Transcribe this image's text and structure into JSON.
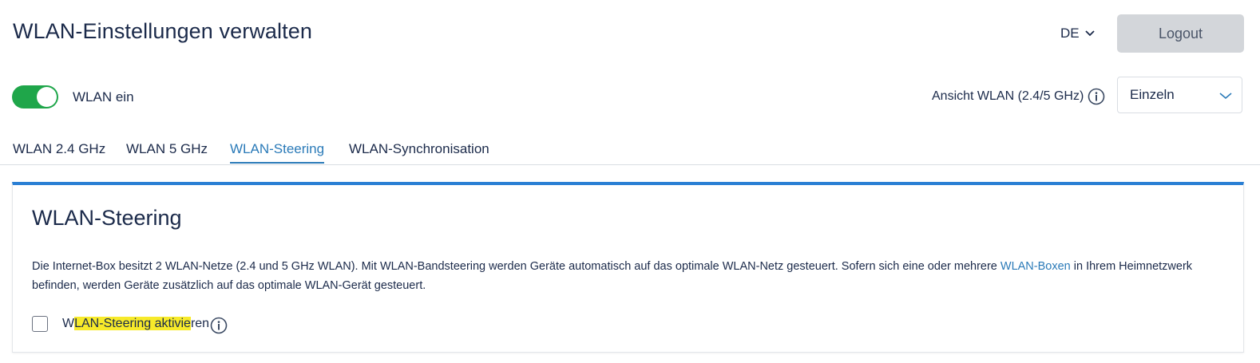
{
  "header": {
    "title": "WLAN-Einstellungen verwalten",
    "language": "DE",
    "logout_label": "Logout"
  },
  "wlan_toggle": {
    "label": "WLAN ein",
    "state": "on"
  },
  "view": {
    "label": "Ansicht WLAN (2.4/5 GHz)",
    "selected": "Einzeln"
  },
  "tabs": [
    {
      "label": "WLAN 2.4 GHz",
      "active": false
    },
    {
      "label": "WLAN 5 GHz",
      "active": false
    },
    {
      "label": "WLAN-Steering",
      "active": true
    },
    {
      "label": "WLAN-Synchronisation",
      "active": false
    }
  ],
  "card": {
    "title": "WLAN-Steering",
    "text_part1": "Die Internet-Box besitzt 2 WLAN-Netze (2.4 und 5 GHz WLAN). Mit WLAN-Bandsteering werden Geräte automatisch auf das optimale WLAN-Netz gesteuert. Sofern sich eine oder mehrere ",
    "text_link": "WLAN-Boxen",
    "text_part2": " in Ihrem Heimnetzwerk befinden, werden Geräte zusätzlich auf das optimale WLAN-Gerät gesteuert.",
    "checkbox_label_pre": "W",
    "checkbox_label_highlight": "LAN-Steering aktivie",
    "checkbox_label_post": "ren",
    "checkbox_checked": false
  },
  "colors": {
    "accent": "#2a7ab8",
    "toggle_on": "#1fa64a",
    "highlight": "#f7ea2a"
  },
  "icons": [
    "chevron-down-icon",
    "info-icon"
  ]
}
